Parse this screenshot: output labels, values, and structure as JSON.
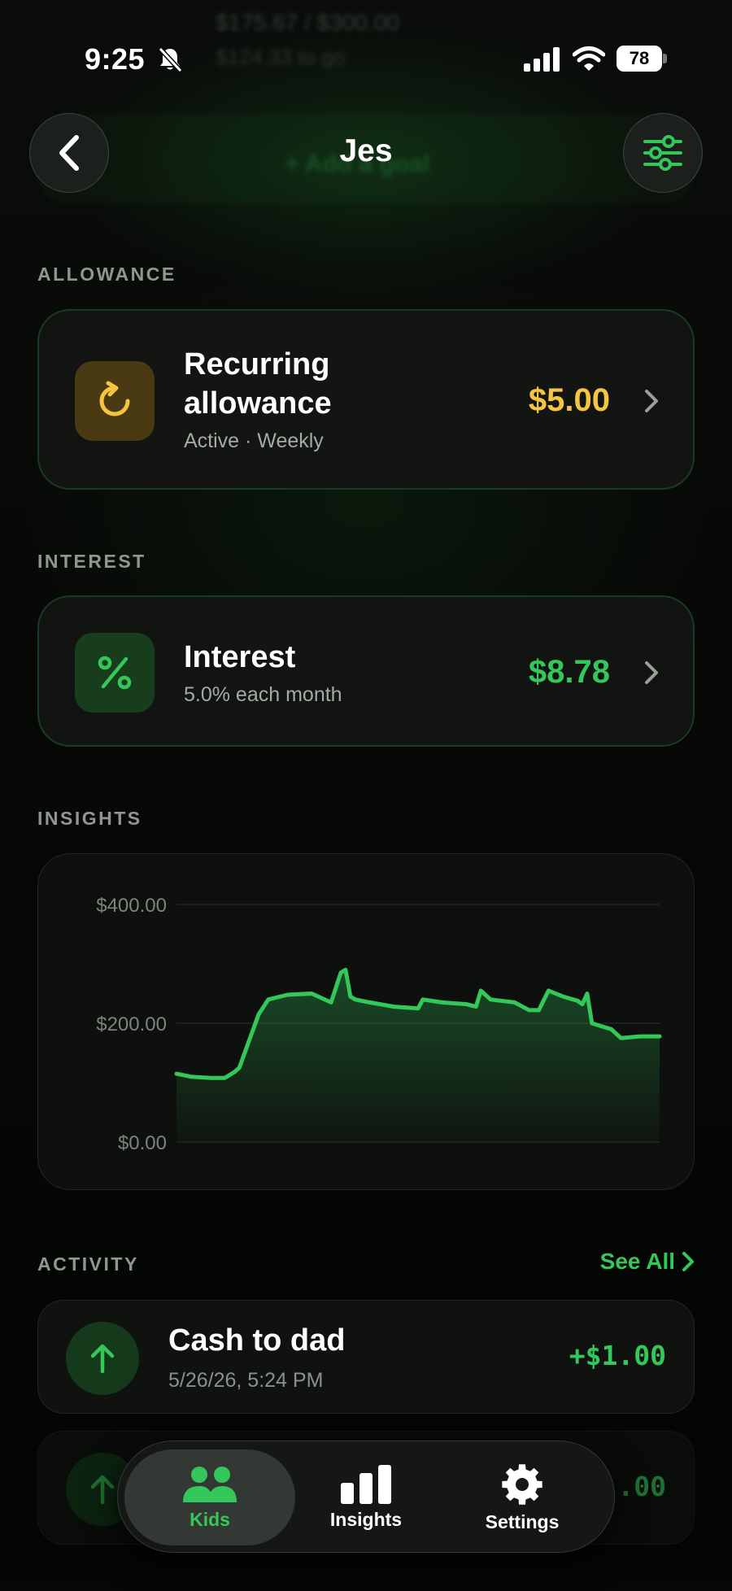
{
  "status_bar": {
    "time": "9:25",
    "battery": "78"
  },
  "header": {
    "title": "Jes"
  },
  "ghost": {
    "line1": "$175.67 / $300.00",
    "line2": "$124.33 to go",
    "add_goal": "+ Add a goal"
  },
  "allowance": {
    "section_label": "ALLOWANCE",
    "title_line1": "Recurring",
    "title_line2": "allowance",
    "subtitle": "Active · Weekly",
    "amount": "$5.00",
    "icon": "refresh-icon",
    "color": "#f5c542"
  },
  "interest": {
    "section_label": "INTEREST",
    "title": "Interest",
    "subtitle": "5.0% each month",
    "amount": "$8.78",
    "icon": "percent-icon",
    "color": "#34c759"
  },
  "insights": {
    "section_label": "INSIGHTS"
  },
  "chart_data": {
    "type": "area",
    "ylim": [
      0,
      400
    ],
    "y_ticks": [
      "$400.00",
      "$200.00",
      "$0.00"
    ],
    "y_tick_values": [
      400,
      200,
      0
    ],
    "x": [
      0,
      3,
      7,
      10,
      12,
      13,
      15,
      17,
      19,
      23,
      28,
      32,
      34,
      35,
      36,
      37,
      40,
      45,
      50,
      51,
      55,
      60,
      62,
      63,
      65,
      70,
      73,
      75,
      77,
      80,
      83,
      84,
      85,
      86,
      88,
      90,
      92,
      96,
      100
    ],
    "values": [
      115,
      110,
      108,
      108,
      118,
      125,
      170,
      215,
      240,
      248,
      250,
      235,
      285,
      290,
      245,
      240,
      235,
      228,
      225,
      240,
      235,
      232,
      228,
      255,
      240,
      235,
      222,
      222,
      255,
      245,
      238,
      232,
      250,
      200,
      195,
      190,
      175,
      178,
      178
    ],
    "grid": true,
    "line_color": "#34c759"
  },
  "activity": {
    "section_label": "ACTIVITY",
    "see_all": "See All",
    "items": [
      {
        "title": "Cash to dad",
        "time": "5/26/26, 5:24 PM",
        "amount": "+$1.00"
      },
      {
        "title": "",
        "time": "",
        "amount": ".00"
      }
    ]
  },
  "tabs": [
    {
      "label": "Kids",
      "icon": "people-icon",
      "active": true
    },
    {
      "label": "Insights",
      "icon": "bar-chart-icon",
      "active": false
    },
    {
      "label": "Settings",
      "icon": "gear-icon",
      "active": false
    }
  ]
}
